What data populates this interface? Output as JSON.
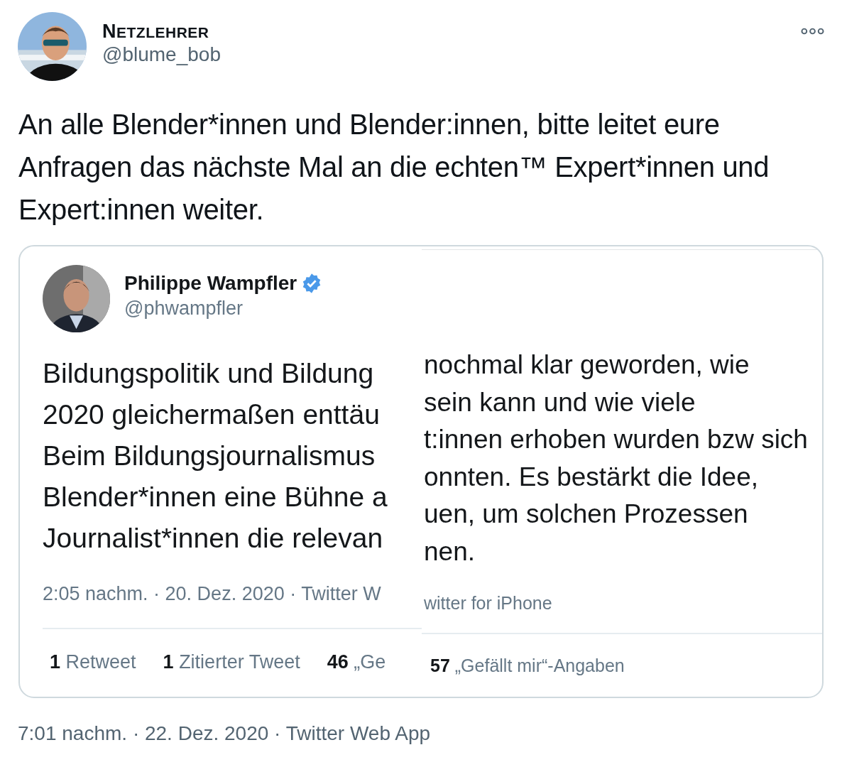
{
  "tweet": {
    "author_name": "NETZLEHRER",
    "handle": "@blume_bob",
    "avatar": {
      "kind": "picture"
    },
    "text": "An alle Blender*innen und Blender:innen, bitte leitet eure Anfragen das nächste Mal an die echten™ Expert*innen und Expert:innen weiter.",
    "embedded_image": {
      "left": {
        "author_name": "Philippe Wampfler",
        "verified": true,
        "handle": "@phwampfler",
        "avatar": {
          "kind": "picture"
        },
        "text_lines": [
          "Bildungspolitik und Bildung",
          "2020 gleichermaßen enttäu",
          "Beim Bildungsjournalismus",
          "Blender*innen eine Bühne a",
          "Journalist*innen die relevan"
        ],
        "meta": "2:05 nachm. · 20. Dez. 2020 · Twitter W",
        "stats": [
          {
            "count": "1",
            "label": "Retweet"
          },
          {
            "count": "1",
            "label": "Zitierter Tweet"
          },
          {
            "count": "46",
            "label": "„Ge"
          }
        ]
      },
      "right": {
        "text_lines": [
          "nochmal klar geworden, wie",
          "sein kann und wie viele",
          "t:innen erhoben wurden bzw sich",
          "onnten. Es bestärkt die Idee,",
          "uen, um solchen Prozessen",
          "nen."
        ],
        "meta": "witter for iPhone",
        "stats": [
          {
            "count": "57",
            "label": "„Gefällt mir“-Angaben"
          }
        ]
      }
    },
    "timestamp": "7:01 nachm. · 22. Dez. 2020 · Twitter Web App"
  }
}
